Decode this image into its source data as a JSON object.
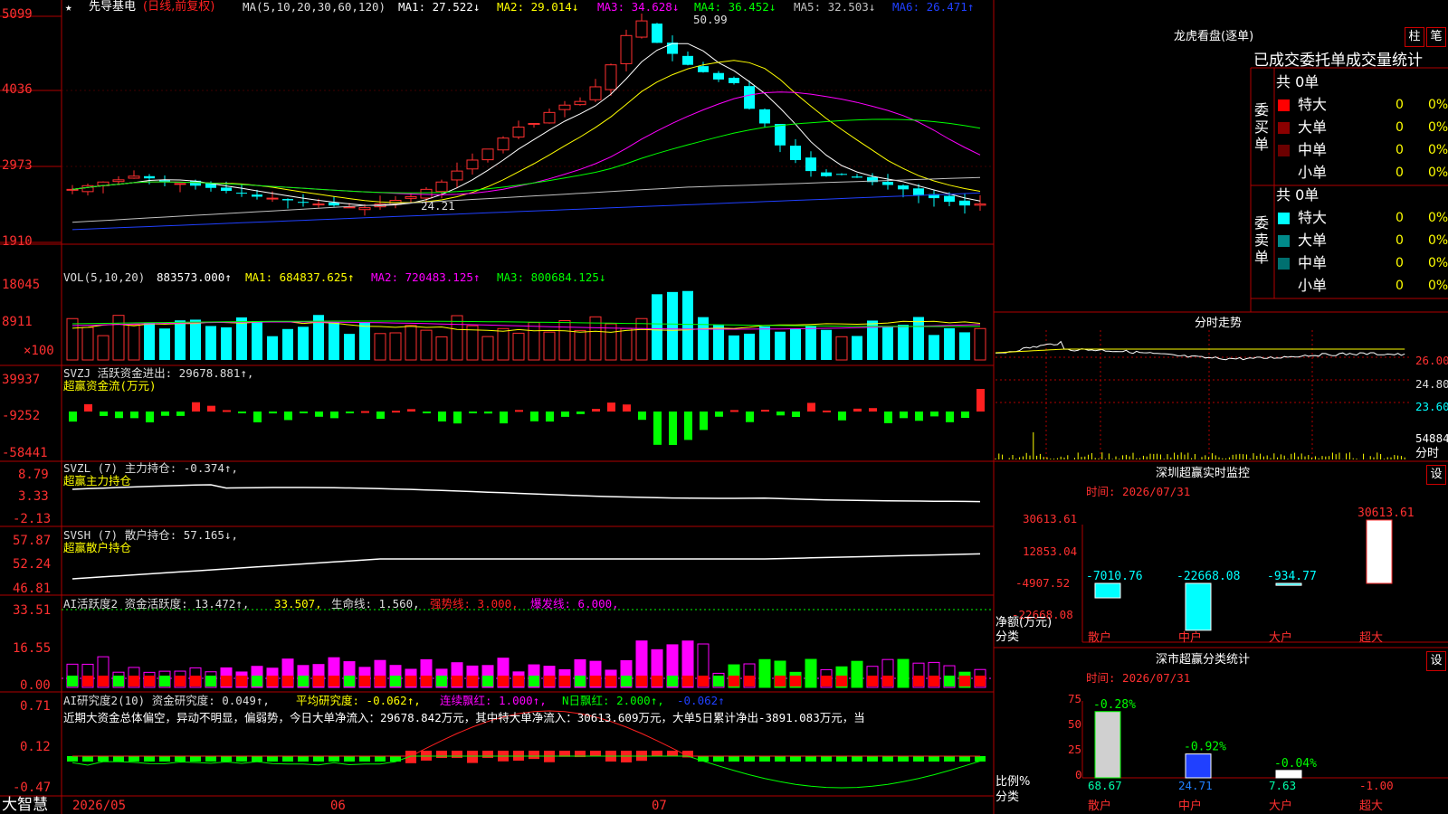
{
  "stock": {
    "name": "先导基电",
    "period": "(日线,前复权)",
    "star": "★",
    "ma_label": "MA(5,10,20,30,60,120)",
    "ma1": "MA1: 27.522↓",
    "ma2": "MA2: 29.014↓",
    "ma3": "MA3: 34.628↓",
    "ma4": "MA4: 36.452↓",
    "ma5": "MA5: 32.503↓",
    "ma6": "MA6: 26.471↑",
    "high_label": "50.99",
    "low_label": "24.21"
  },
  "vol": {
    "label": "VOL(5,10,20)",
    "value": "883573.000↑",
    "ma1": "MA1: 684837.625↑",
    "ma2": "MA2: 720483.125↑",
    "ma3": "MA3: 800684.125↓"
  },
  "svzj": {
    "label": "SVZJ  活跃资金进出: 29678.881↑,",
    "sub": "超赢资金流(万元)"
  },
  "svzl": {
    "label": "SVZL (7) 主力持仓: -0.374↑,",
    "sub": "超赢主力持仓"
  },
  "svsh": {
    "label": "SVSH (7) 散户持仓: 57.165↓,",
    "sub": "超赢散户持仓"
  },
  "ai2": {
    "a": "AI活跃度2 资金活跃度: 13.472↑,",
    "b": "33.507,",
    "c": "生命线: 1.560,",
    "d": "强势线: 3.000,",
    "e": "爆发线: 6.000,"
  },
  "ai_res": {
    "a": "AI研究度2(10) 资金研究度: 0.049↑,",
    "b": "平均研究度: -0.062↑,",
    "c": "连续飘红: 1.000↑,",
    "d": "N日飘红: 2.000↑,",
    "e": "-0.062↑",
    "text": "近期大资金总体偏空，异动不明显，偏弱势，今日大单净流入：29678.842万元，其中特大单净流入：30613.609万元，大单5日累计净出-3891.083万元，当"
  },
  "axes": {
    "price": [
      "5099",
      "4036",
      "2973",
      "1910"
    ],
    "vol": [
      "18045",
      "8911",
      "×100"
    ],
    "svzj": [
      "39937",
      "-9252",
      "-58441"
    ],
    "svzl": [
      "8.79",
      "3.33",
      "-2.13"
    ],
    "svsh": [
      "57.87",
      "52.24",
      "46.81"
    ],
    "ai2": [
      "33.51",
      "16.55",
      "0.00"
    ],
    "ai_res": [
      "0.71",
      "0.12",
      "-0.47"
    ]
  },
  "dates": [
    "2026/05",
    "06",
    "07"
  ],
  "brand": "大智慧",
  "lhb": {
    "title": "龙虎看盘(逐单)",
    "btn1": "柱",
    "btn2": "笔",
    "tabs": "已成交委托单成交量统计",
    "buy_total": "共 0单",
    "sell_total": "共 0单",
    "buy_label": "委买单",
    "sell_label": "委卖单",
    "rows_buy": [
      {
        "name": "特大",
        "n": "0",
        "p": "0%",
        "color": "#ff0000"
      },
      {
        "name": "大单",
        "n": "0",
        "p": "0%",
        "color": "#8b0000"
      },
      {
        "name": "中单",
        "n": "0",
        "p": "0%",
        "color": "#6b0000"
      },
      {
        "name": "小单",
        "n": "0",
        "p": "0%",
        "color": "#000000"
      }
    ],
    "rows_sell": [
      {
        "name": "特大",
        "n": "0",
        "p": "0%",
        "color": "#00ffff"
      },
      {
        "name": "大单",
        "n": "0",
        "p": "0%",
        "color": "#008b8b"
      },
      {
        "name": "中单",
        "n": "0",
        "p": "0%",
        "color": "#007070"
      },
      {
        "name": "小单",
        "n": "0",
        "p": "0%",
        "color": "#000000"
      }
    ]
  },
  "intraday": {
    "title": "分时走势",
    "p1": "26.00",
    "p2": "24.80",
    "p3": "23.60",
    "vol": "54884",
    "lbl": "分时"
  },
  "sz_monitor": {
    "title": "深圳超赢实时监控",
    "btn": "设",
    "time": "时间: 2026/07/31",
    "yaxis": [
      "30613.61",
      "12853.04",
      "-4907.52",
      "-22668.08"
    ],
    "ylabel": "净额(万元)",
    "xlabel": "分类",
    "cats": [
      "散户",
      "中户",
      "大户",
      "超大"
    ],
    "values": [
      -7010.76,
      -22668.08,
      -934.77,
      30613.61
    ],
    "value_labels": [
      "-7010.76",
      "-22668.08",
      "-934.77",
      "30613.61"
    ]
  },
  "sz_class": {
    "title": "深市超赢分类统计",
    "btn": "设",
    "time": "时间: 2026/07/31",
    "yaxis": [
      "75",
      "50",
      "25",
      "0"
    ],
    "ylabel": "比例%",
    "xlabel": "分类",
    "cats": [
      "散户",
      "中户",
      "大户",
      "超大"
    ],
    "values": [
      68.67,
      24.71,
      7.63,
      -1.0
    ],
    "value_labels": [
      "68.67",
      "24.71",
      "7.63",
      "-1.00"
    ],
    "changes": [
      "-0.28%",
      "-0.92%",
      "-0.04%",
      ""
    ]
  }
}
